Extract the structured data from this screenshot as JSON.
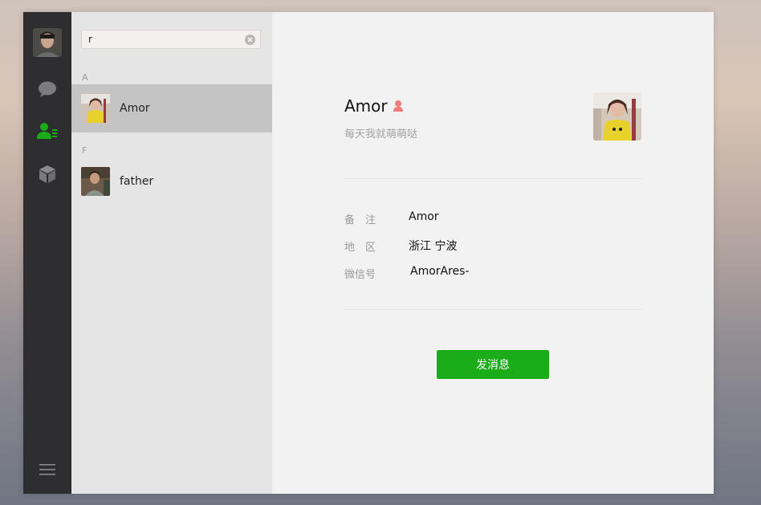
{
  "search": {
    "value": "r",
    "clear_icon": "clear-icon"
  },
  "sidebar": {
    "icons": [
      "chat-icon",
      "contacts-icon",
      "favorites-cube-icon",
      "menu-icon"
    ],
    "active": "contacts-icon",
    "accent_color": "#1aad19"
  },
  "contacts": {
    "groups": [
      {
        "letter": "A",
        "items": [
          {
            "name": "Amor",
            "selected": true
          }
        ]
      },
      {
        "letter": "F",
        "items": [
          {
            "name": "father",
            "selected": false
          }
        ]
      }
    ]
  },
  "profile": {
    "nickname": "Amor",
    "gender_icon": "female-icon",
    "gender_color": "#f37b7b",
    "signature": "每天我就萌萌哒",
    "fields": [
      {
        "label": "备　注",
        "value": "Amor"
      },
      {
        "label": "地　区",
        "value": "浙江 宁波"
      },
      {
        "label": "微信号",
        "value": "AmorAres-"
      }
    ],
    "send_button": "发消息"
  }
}
